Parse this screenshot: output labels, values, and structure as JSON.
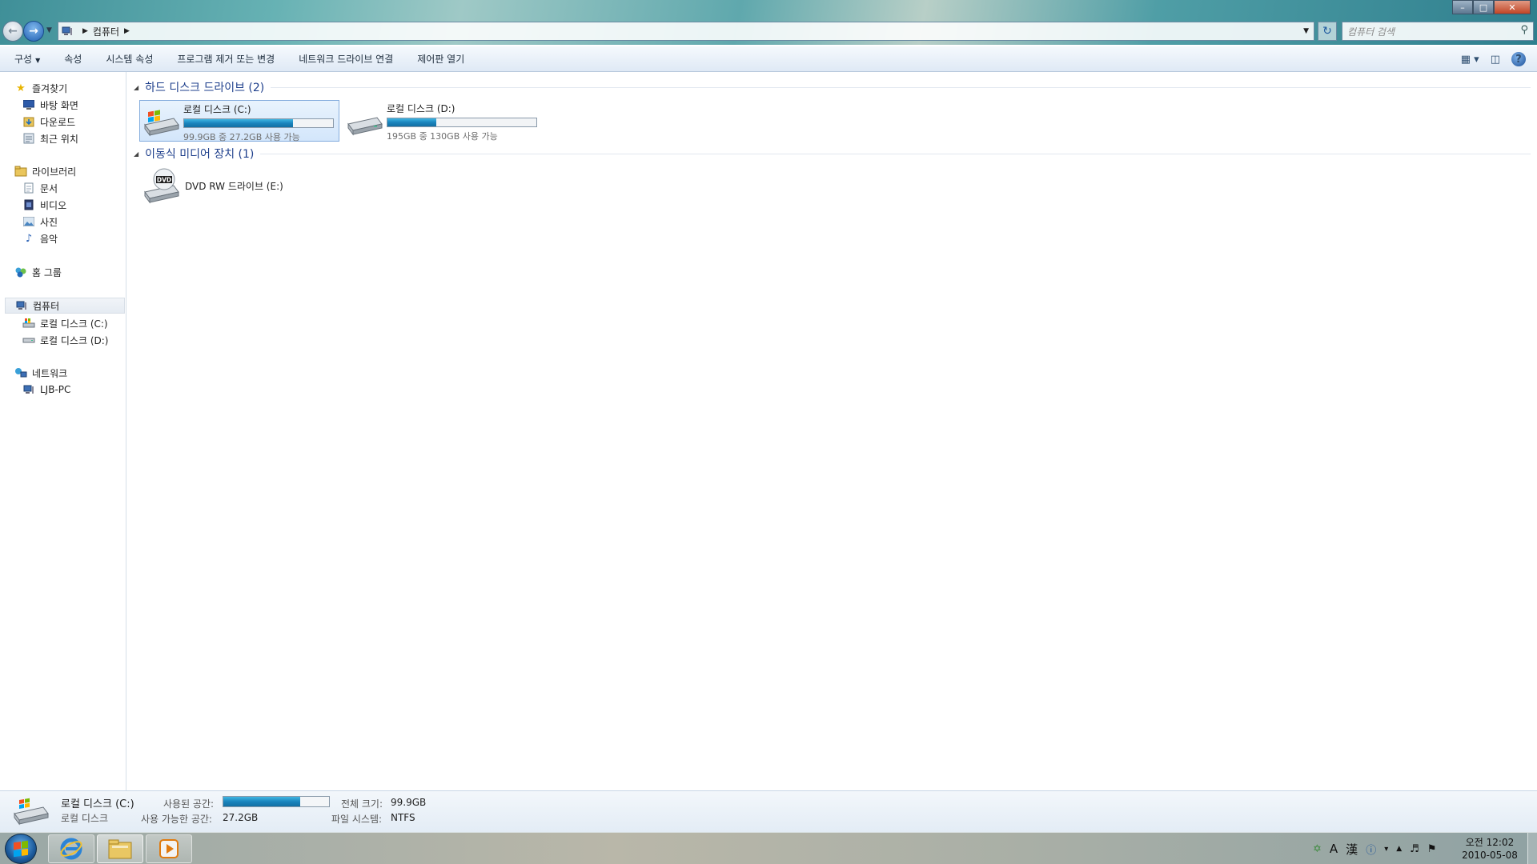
{
  "address": {
    "path": [
      "컴퓨터"
    ],
    "search_placeholder": "컴퓨터 검색"
  },
  "toolbar": {
    "items": [
      "구성",
      "속성",
      "시스템 속성",
      "프로그램 제거 또는 변경",
      "네트워크 드라이브 연결",
      "제어판 열기"
    ]
  },
  "nav": {
    "favorites": {
      "label": "즐겨찾기",
      "items": [
        "바탕 화면",
        "다운로드",
        "최근 위치"
      ]
    },
    "libraries": {
      "label": "라이브러리",
      "items": [
        "문서",
        "비디오",
        "사진",
        "음악"
      ]
    },
    "homegroup": {
      "label": "홈 그룹"
    },
    "computer": {
      "label": "컴퓨터",
      "items": [
        "로컬 디스크 (C:)",
        "로컬 디스크 (D:)"
      ]
    },
    "network": {
      "label": "네트워크",
      "items": [
        "LJB-PC"
      ]
    }
  },
  "content": {
    "hdd_group": "하드 디스크 드라이브 (2)",
    "removable_group": "이동식 미디어 장치 (1)",
    "drives": [
      {
        "name": "로컬 디스크 (C:)",
        "free": "99.9GB 중 27.2GB 사용 가능",
        "used_fraction": 0.73
      },
      {
        "name": "로컬 디스크 (D:)",
        "free": "195GB 중 130GB 사용 가능",
        "used_fraction": 0.33
      }
    ],
    "dvd": {
      "name": "DVD RW 드라이브 (E:)",
      "badge": "DVD"
    }
  },
  "details": {
    "name": "로컬 디스크 (C:)",
    "type": "로컬 디스크",
    "used_label": "사용된 공간:",
    "free_label": "사용 가능한 공간:",
    "free_value": "27.2GB",
    "total_label": "전체 크기:",
    "total_value": "99.9GB",
    "fs_label": "파일 시스템:",
    "fs_value": "NTFS",
    "used_fraction": 0.73
  },
  "taskbar": {
    "time": "오전 12:02",
    "date": "2010-05-08",
    "ime_a": "A",
    "ime_han": "漢"
  },
  "colors": {
    "accent": "#1e3f8c",
    "bar_fill": "#1a84bd"
  }
}
